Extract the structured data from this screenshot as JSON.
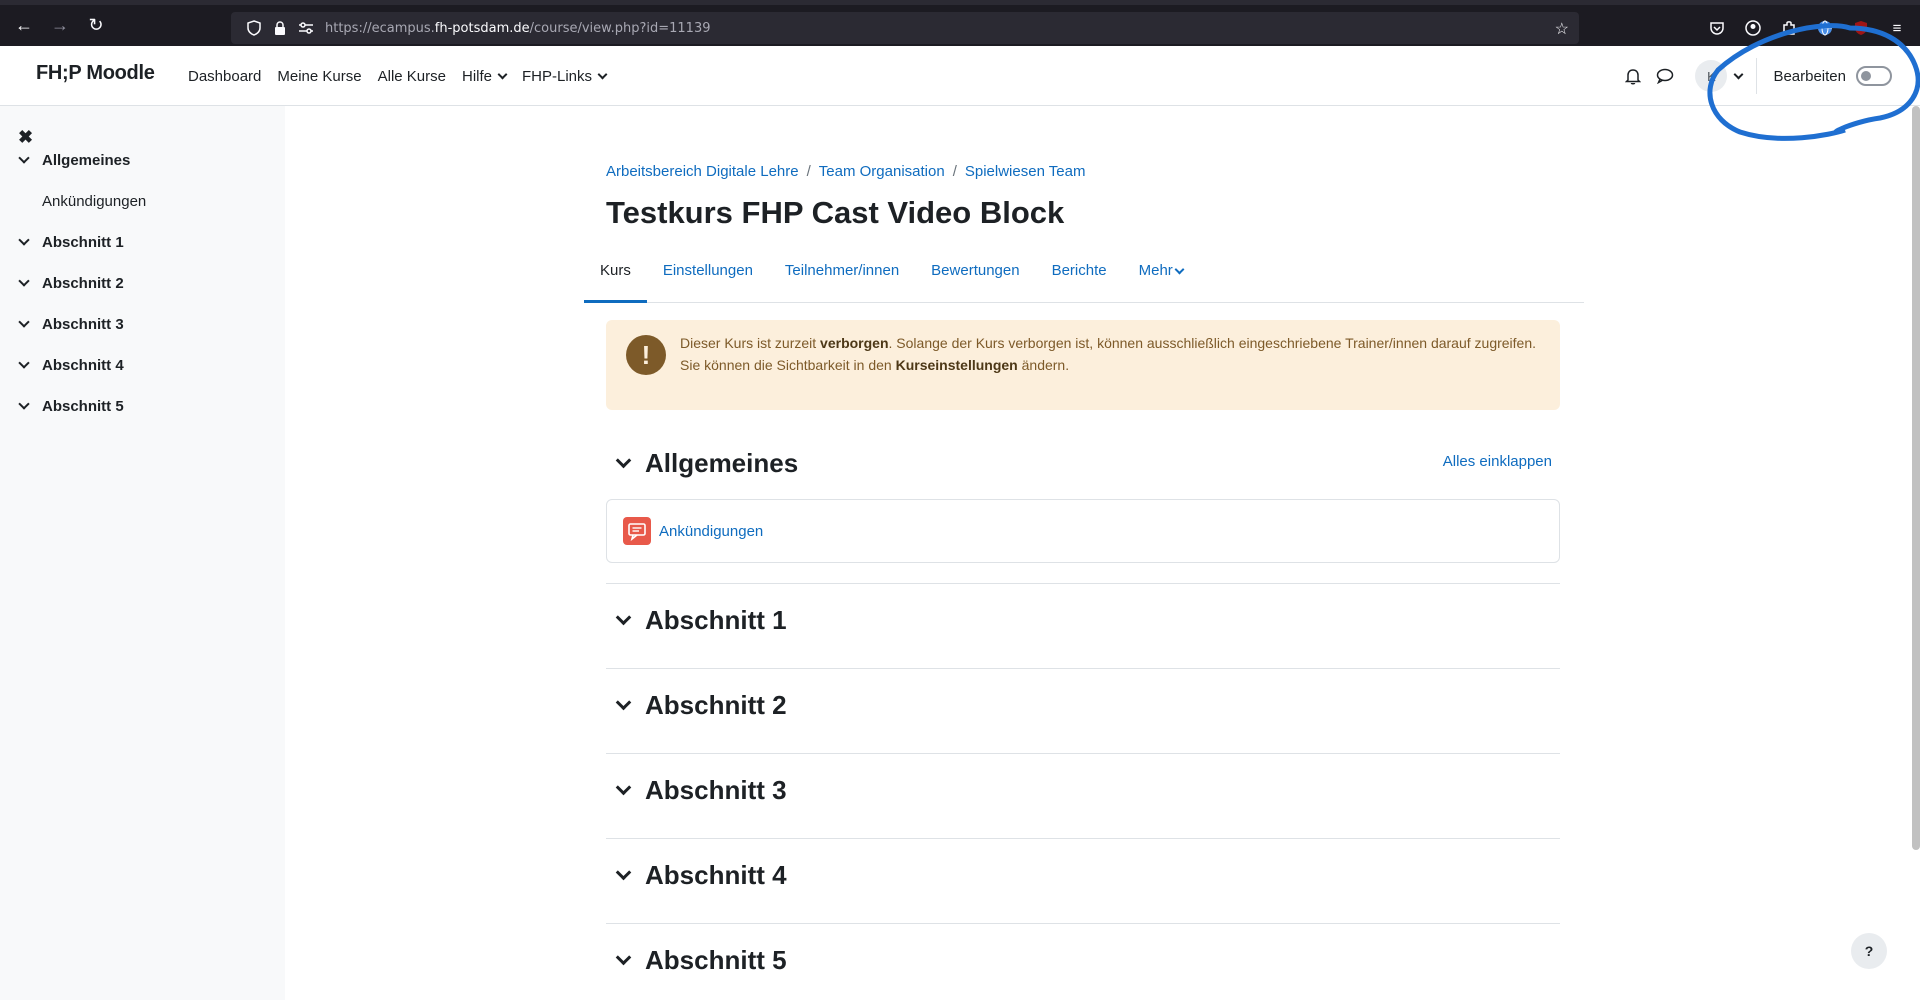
{
  "browser": {
    "url_prefix": "https://ecampus.",
    "url_host": "fh-potsdam.de",
    "url_path": "/course/view.php?id=11139"
  },
  "navbar": {
    "brand": "FH;P Moodle",
    "links": [
      "Dashboard",
      "Meine Kurse",
      "Alle Kurse",
      "Hilfe",
      "FHP-Links"
    ],
    "avatar_initial": "K",
    "edit_label": "Bearbeiten",
    "edit_mode_on": false
  },
  "drawer": {
    "items": [
      {
        "label": "Allgemeines",
        "children": [
          "Ankündigungen"
        ]
      },
      {
        "label": "Abschnitt 1"
      },
      {
        "label": "Abschnitt 2"
      },
      {
        "label": "Abschnitt 3"
      },
      {
        "label": "Abschnitt 4"
      },
      {
        "label": "Abschnitt 5"
      }
    ]
  },
  "breadcrumb": [
    "Arbeitsbereich Digitale Lehre",
    "Team Organisation",
    "Spielwiesen Team"
  ],
  "page_title": "Testkurs FHP Cast Video Block",
  "tabs": [
    "Kurs",
    "Einstellungen",
    "Teilnehmer/innen",
    "Bewertungen",
    "Berichte",
    "Mehr"
  ],
  "alert": {
    "line1_pre": "Dieser Kurs ist zurzeit ",
    "line1_bold": "verborgen",
    "line1_post": ". Solange der Kurs verborgen ist, können ausschließlich eingeschriebene Trainer/innen darauf zugreifen.",
    "line2_pre": "Sie können die Sichtbarkeit in den ",
    "line2_bold": "Kurseinstellungen",
    "line2_post": " ändern."
  },
  "collapse_all": "Alles einklappen",
  "sections": [
    "Allgemeines",
    "Abschnitt 1",
    "Abschnitt 2",
    "Abschnitt 3",
    "Abschnitt 4",
    "Abschnitt 5"
  ],
  "activity": {
    "label": "Ankündigungen",
    "icon": "forum-icon"
  },
  "help_label": "?",
  "colors": {
    "link": "#0f6cbf",
    "annotation": "#1f6fd1",
    "alert_bg": "#fcefdc"
  }
}
